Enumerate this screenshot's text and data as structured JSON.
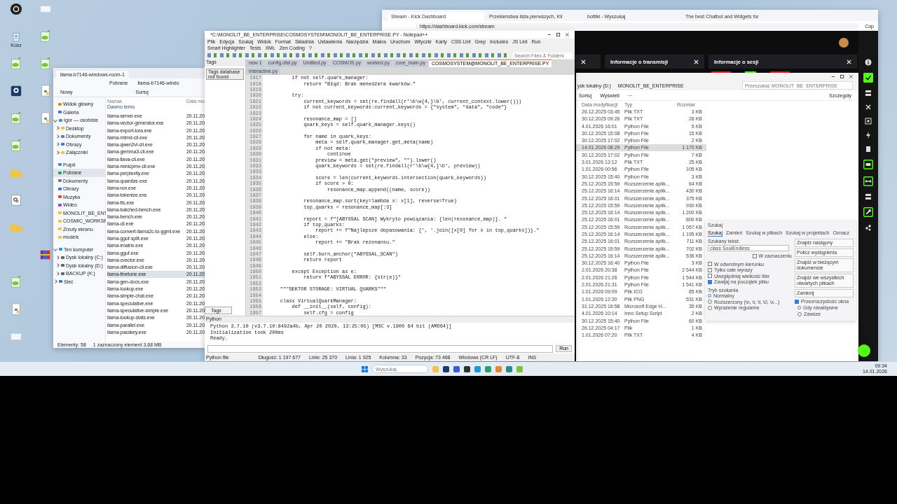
{
  "desktop": {
    "columns": [
      [
        {
          "kind": "obs"
        },
        {
          "kind": "recycle",
          "label": "Kosz"
        },
        {
          "kind": "notepad"
        },
        {
          "kind": "webcam"
        },
        {
          "kind": "notepad"
        },
        {
          "kind": "notepad"
        },
        {
          "kind": "folder"
        },
        {
          "kind": "settings"
        },
        {
          "kind": "folder"
        },
        {
          "kind": "empty"
        },
        {
          "kind": "notepad"
        },
        {
          "kind": "python"
        },
        {
          "kind": "doc"
        }
      ],
      [
        {
          "kind": "doc"
        },
        {
          "kind": "notepad"
        },
        {
          "kind": "notepad"
        },
        {
          "kind": "python"
        },
        {
          "kind": "python"
        },
        {
          "kind": "empty"
        },
        {
          "kind": "empty"
        },
        {
          "kind": "empty"
        },
        {
          "kind": "empty"
        },
        {
          "kind": "winrar"
        }
      ]
    ]
  },
  "browser": {
    "tabs": [
      {
        "title": "Stream - Kick Dashboard",
        "selected": true
      },
      {
        "title": "Przekleństwa lista pierwszych, Kli",
        "selected": false
      },
      {
        "title": "bottiki - Wyszukaj",
        "selected": false
      },
      {
        "title": "The best Chatbot and Widgets for",
        "selected": false
      }
    ],
    "url": "https://dashboard.kick.com/stream",
    "copilot": "Cop",
    "panels": [
      {
        "title": "Informacje o transmisji"
      },
      {
        "title": "Informacje o sesji"
      }
    ]
  },
  "explorer_right": {
    "breadcrumb": [
      "ysk lokalny (D:)",
      "MONOLIT_BE_ENTERPRISE"
    ],
    "search": {
      "placeholder": "Przeszukaj: MONOLIT_BE_ENTERPRISE"
    },
    "toolbar": [
      "Sortuj",
      "Wyświetl",
      "···"
    ],
    "details": "Szczegóły",
    "columns": [
      "Data modyfikacji",
      "Typ",
      "Rozmiar"
    ],
    "rows": [
      {
        "date": "26.12.2025 03:45",
        "type": "Plik TXT",
        "size": "3 KB",
        "selected": false
      },
      {
        "date": "30.12.2025 09:26",
        "type": "Plik TXT",
        "size": "26 KB",
        "selected": false
      },
      {
        "date": "4.01.2026 16:01",
        "type": "Python File",
        "size": "5 KB",
        "selected": false
      },
      {
        "date": "30.12.2025 15:08",
        "type": "Python File",
        "size": "15 KB",
        "selected": false
      },
      {
        "date": "30.12.2025 17:02",
        "type": "Python File",
        "size": "2 KB",
        "selected": false
      },
      {
        "date": "14.01.2026 08:29",
        "type": "Python File",
        "size": "1 170 KB",
        "selected": true
      },
      {
        "date": "30.12.2025 17:02",
        "type": "Python File",
        "size": "7 KB",
        "selected": false
      },
      {
        "date": "3.01.2026 12:12",
        "type": "Plik TXT",
        "size": "25 KB",
        "selected": false
      },
      {
        "date": "1.01.2026 00:56",
        "type": "Python File",
        "size": "105 KB",
        "selected": false
      },
      {
        "date": "30.12.2025 15:40",
        "type": "Python File",
        "size": "3 KB",
        "selected": false
      },
      {
        "date": "25.12.2025 15:59",
        "type": "Rozszerzenie aplik...",
        "size": "64 KB",
        "selected": false
      },
      {
        "date": "25.12.2025 16:14",
        "type": "Rozszerzenie aplik...",
        "size": "430 KB",
        "selected": false
      },
      {
        "date": "25.12.2025 16:01",
        "type": "Rozszerzenie aplik...",
        "size": "375 KB",
        "selected": false
      },
      {
        "date": "25.12.2025 15:59",
        "type": "Rozszerzenie aplik...",
        "size": "930 KB",
        "selected": false
      },
      {
        "date": "25.12.2025 16:14",
        "type": "Rozszerzenie aplik...",
        "size": "1 200 KB",
        "selected": false
      },
      {
        "date": "25.12.2025 16:01",
        "type": "Rozszerzenie aplik...",
        "size": "800 KB",
        "selected": false
      },
      {
        "date": "25.12.2025 15:59",
        "type": "Rozszerzenie aplik...",
        "size": "1 057 KB",
        "selected": false
      },
      {
        "date": "25.12.2025 16:14",
        "type": "Rozszerzenie aplik...",
        "size": "1 195 KB",
        "selected": false
      },
      {
        "date": "25.12.2025 16:01",
        "type": "Rozszerzenie aplik...",
        "size": "711 KB",
        "selected": false
      },
      {
        "date": "25.12.2025 15:59",
        "type": "Rozszerzenie aplik...",
        "size": "702 KB",
        "selected": false
      },
      {
        "date": "25.12.2025 16:14",
        "type": "Rozszerzenie aplik...",
        "size": "536 KB",
        "selected": false
      },
      {
        "date": "30.12.2025 16:40",
        "type": "Python File",
        "size": "3 KB",
        "selected": false
      },
      {
        "date": "2.01.2026 20:38",
        "type": "Python File",
        "size": "2 544 KB",
        "selected": false
      },
      {
        "date": "2.01.2026 21:26",
        "type": "Python File",
        "size": "1 544 KB",
        "selected": false
      },
      {
        "date": "2.01.2026 21:31",
        "type": "Python File",
        "size": "1 541 KB",
        "selected": false
      },
      {
        "date": "1.01.2026 09:09",
        "type": "Plik ICO",
        "size": "85 KB",
        "selected": false
      },
      {
        "date": "1.01.2026 12:30",
        "type": "Plik PNG",
        "size": "531 KB",
        "selected": false
      },
      {
        "date": "31.12.2025 16:58",
        "type": "Microsoft Edge H...",
        "size": "35 KB",
        "selected": false
      },
      {
        "date": "4.01.2026 10:14",
        "type": "Inno Setup Script",
        "size": "2 KB",
        "selected": false
      },
      {
        "date": "30.12.2025 15:40",
        "type": "Python File",
        "size": "60 KB",
        "selected": false
      },
      {
        "date": "26.12.2025 04:17",
        "type": "Plik",
        "size": "1 KB",
        "selected": false
      },
      {
        "date": "1.01.2026 07:20",
        "type": "Plik TXT",
        "size": "4 KB",
        "selected": false
      }
    ]
  },
  "explorer_left": {
    "tab": "llama-b7146-windows-rocm-1",
    "breadcrumb": [
      "Pobrane",
      "llama-b7146-windo"
    ],
    "toolbar": [
      "Nowy",
      "Sortuj"
    ],
    "nav": [
      [
        {
          "label": "Widok główny",
          "kind": "home",
          "selected": false
        },
        {
          "label": "Galeria",
          "kind": "gallery",
          "selected": false
        },
        {
          "label": "Igor — osobiste",
          "kind": "cloud",
          "selected": false,
          "expanded": true,
          "children": [
            {
              "label": "Desktop",
              "kind": "folder",
              "selected": false,
              "expanded": false
            },
            {
              "label": "Dokumenty",
              "kind": "doc",
              "selected": false,
              "expanded": false
            },
            {
              "label": "Obrazy",
              "kind": "image",
              "selected": false,
              "expanded": false
            },
            {
              "label": "Załączniki",
              "kind": "folder",
              "selected": false,
              "expanded": false
            }
          ]
        }
      ],
      [
        {
          "label": "Pulpit",
          "kind": "desktop",
          "selected": false
        },
        {
          "label": "Pobrane",
          "kind": "download",
          "selected": true
        },
        {
          "label": "Dokumenty",
          "kind": "doc",
          "selected": false
        },
        {
          "label": "Obrazy",
          "kind": "image",
          "selected": false
        },
        {
          "label": "Muzyka",
          "kind": "music",
          "selected": false
        },
        {
          "label": "Wideo",
          "kind": "video",
          "selected": false
        },
        {
          "label": "MONOLIT_BE_ENT",
          "kind": "folder",
          "selected": false
        },
        {
          "label": "COSMIC_WORKSP",
          "kind": "folder",
          "selected": false
        },
        {
          "label": "Zrzuty ekranu",
          "kind": "folder",
          "selected": false
        },
        {
          "label": "models",
          "kind": "folder",
          "selected": false
        }
      ],
      [
        {
          "label": "Ten komputer",
          "kind": "pc",
          "selected": false,
          "expanded": true,
          "children": [
            {
              "label": "Dysk lokalny (C:)",
              "kind": "drive",
              "selected": false,
              "expanded": false
            },
            {
              "label": "Dysk lokalny (D:)",
              "kind": "drive",
              "selected": false,
              "expanded": false
            },
            {
              "label": "BACKUP (K:)",
              "kind": "drive",
              "selected": false,
              "expanded": false
            }
          ]
        },
        {
          "label": "Sieć",
          "kind": "network",
          "selected": false,
          "expanded": false
        }
      ]
    ],
    "columns": [
      "Nazwa",
      "Data mo"
    ],
    "group": "Dawno temu",
    "files": [
      {
        "name": "llama-server.exe",
        "date": "20.11.20",
        "selected": false
      },
      {
        "name": "llama-vector-generator.exe",
        "date": "20.11.20",
        "selected": false
      },
      {
        "name": "llama-export-lora.exe",
        "date": "20.11.20",
        "selected": false
      },
      {
        "name": "llama-mtmd-cli.exe",
        "date": "20.11.20",
        "selected": false
      },
      {
        "name": "llama-qwen2vl-cli.exe",
        "date": "20.11.20",
        "selected": false
      },
      {
        "name": "llama-gemma3-cli.exe",
        "date": "20.11.20",
        "selected": false
      },
      {
        "name": "llama-llava-cli.exe",
        "date": "20.11.20",
        "selected": false
      },
      {
        "name": "llama-minicpmv-cli.exe",
        "date": "20.11.20",
        "selected": false
      },
      {
        "name": "llama-perplexity.exe",
        "date": "20.11.20",
        "selected": false
      },
      {
        "name": "llama-quantize.exe",
        "date": "20.11.20",
        "selected": false
      },
      {
        "name": "llama-run.exe",
        "date": "20.11.20",
        "selected": false
      },
      {
        "name": "llama-tokenize.exe",
        "date": "20.11.20",
        "selected": false
      },
      {
        "name": "llama-tts.exe",
        "date": "20.11.20",
        "selected": false
      },
      {
        "name": "llama-batched-bench.exe",
        "date": "20.11.20",
        "selected": false
      },
      {
        "name": "llama-bench.exe",
        "date": "20.11.20",
        "selected": false
      },
      {
        "name": "llama-cli.exe",
        "date": "20.11.20",
        "selected": false
      },
      {
        "name": "llama-convert-llama2c-to-ggml.exe",
        "date": "20.11.20",
        "selected": false
      },
      {
        "name": "llama-gguf-split.exe",
        "date": "20.11.20",
        "selected": false
      },
      {
        "name": "llama-imatrix.exe",
        "date": "20.11.20",
        "selected": false
      },
      {
        "name": "llama-gguf.exe",
        "date": "20.11.20",
        "selected": false
      },
      {
        "name": "llama-cvector.exe",
        "date": "20.11.20",
        "selected": false
      },
      {
        "name": "llama-diffusion-cli.exe",
        "date": "20.11.20",
        "selected": false
      },
      {
        "name": "llama-finetune.exe",
        "date": "20.11.20",
        "selected": true
      },
      {
        "name": "llama-gen-docs.exe",
        "date": "20.11.20",
        "selected": false
      },
      {
        "name": "llama-lookup.exe",
        "date": "20.11.20",
        "selected": false
      },
      {
        "name": "llama-simple-chat.exe",
        "date": "20.11.20",
        "selected": false
      },
      {
        "name": "llama-speculative.exe",
        "date": "20.11.20",
        "selected": false
      },
      {
        "name": "llama-speculative-simple.exe",
        "date": "20.11.20",
        "selected": false
      },
      {
        "name": "llama-lookup-stats.exe",
        "date": "20.11.20",
        "selected": false
      },
      {
        "name": "llama-parallel.exe",
        "date": "20.11.20",
        "selected": false
      },
      {
        "name": "llama-passkey.exe",
        "date": "20.11.20",
        "selected": false
      }
    ],
    "status": [
      "Elementy: 58",
      "1 zaznaczony element  3,68 MB"
    ]
  },
  "editor": {
    "title": "*C:\\MONOLIT_BE_ENTERPRISE\\COSMOSYSTEM\\MONOLIT_BE_ENTERPRISE.PY - Notepad++",
    "menu": [
      "Plik",
      "Edycja",
      "Szukaj",
      "Widok",
      "Format",
      "Składnia",
      "Ustawienia",
      "Narzędzia",
      "Makra",
      "Uruchom",
      "Wtyczki",
      "Karty",
      "CSS Lint",
      "Grep",
      "Includes",
      "JS Lint",
      "Run",
      "Smart Highlighter",
      "Tests",
      "XML",
      "Zen Coding",
      "?"
    ],
    "search": {
      "placeholder": "Search Files & Folders"
    },
    "tabs": [
      {
        "title": "new 1",
        "selected": false
      },
      {
        "title": "config.dist.py",
        "selected": false
      },
      {
        "title": "Untitled.py",
        "selected": false
      },
      {
        "title": "COSMOS.py",
        "selected": false
      },
      {
        "title": "worked.py",
        "selected": false
      },
      {
        "title": "core_main.py",
        "selected": false
      },
      {
        "title": "COSMOSYSTEM@MONOLIT_BE_ENTERPRISE.PY",
        "selected": true
      },
      {
        "title": "interactive.py",
        "selected": false
      }
    ],
    "tags": {
      "title": "Tags",
      "message": "Tags database not found",
      "tab": "Tags"
    },
    "lines": [
      {
        "n": "1917",
        "code": "        if not self.quark_manager:"
      },
      {
        "n": "1918",
        "code": "            return \"Błąd: Brak menedżera kwarków.\""
      },
      {
        "n": "1919"
      },
      {
        "n": "1920",
        "code": "        try:"
      },
      {
        "n": "1921",
        "code": "            current_keywords = set(re.findall(r'\\b\\w{4,}\\b', current_context.lower()))"
      },
      {
        "n": "1922",
        "code": "            if not current_keywords:current_keywords = {\"system\", \"data\", \"code\"}"
      },
      {
        "n": "1923"
      },
      {
        "n": "1924",
        "code": "            resonance_map = []"
      },
      {
        "n": "1925",
        "code": "            quark_keys = self.quark_manager.keys()"
      },
      {
        "n": "1926"
      },
      {
        "n": "1927",
        "code": "            for name in quark_keys:"
      },
      {
        "n": "1928",
        "code": "                meta = self.quark_manager.get_meta(name)"
      },
      {
        "n": "1929",
        "code": "                if not meta:"
      },
      {
        "n": "1930",
        "code": "                    continue"
      },
      {
        "n": "1931",
        "code": "                preview = meta.get(\"preview\", \"\").lower()"
      },
      {
        "n": "1932",
        "code": "                quark_keywords = set(re.findall(r'\\b\\w{4,}\\b', preview))"
      },
      {
        "n": "1933"
      },
      {
        "n": "1934",
        "code": "                score = len(current_keywords.intersection(quark_keywords))"
      },
      {
        "n": "1935",
        "code": "                if score > 0:"
      },
      {
        "n": "1936",
        "code": "                    resonance_map.append((name, score))"
      },
      {
        "n": "1937"
      },
      {
        "n": "1938",
        "code": "            resonance_map.sort(key=lambda x: x[1], reverse=True)"
      },
      {
        "n": "1939",
        "code": "            top_quarks = resonance_map[:3]"
      },
      {
        "n": "1940"
      },
      {
        "n": "1941",
        "code": "            report = f\"[ABYSSAL SCAN] Wykryto powiązania: {len(resonance_map)}. \""
      },
      {
        "n": "1942",
        "code": "            if top_quarks:"
      },
      {
        "n": "1943",
        "code": "                report += f\"Najlepsze dopasowania: {', '.join([x[0] for x in top_quarks])}.\""
      },
      {
        "n": "1944",
        "code": "            else:"
      },
      {
        "n": "1945",
        "code": "                report += \"Brak rezonansu.\""
      },
      {
        "n": "1946"
      },
      {
        "n": "1947",
        "code": "            self.burn_anchor(\"ABYSSAL_SCAN\")"
      },
      {
        "n": "1948",
        "code": "            return report"
      },
      {
        "n": "1949"
      },
      {
        "n": "1950",
        "code": "        except Exception as e:"
      },
      {
        "n": "1951",
        "code": "            return f\"ABYSSAL ERROR: {str(e)}\""
      },
      {
        "n": "1952"
      },
      {
        "n": "1953",
        "code": "    \"\"\"SEKTOR STORAGE: VIRTUAL QUARKS\"\"\""
      },
      {
        "n": "1954"
      },
      {
        "n": "1955",
        "code": "    class VirtualQuarkManager:"
      },
      {
        "n": "1956",
        "code": "        def __init__(self, config):"
      },
      {
        "n": "1957",
        "code": "            self.cfg = config"
      }
    ],
    "console": {
      "title": "Python",
      "lines": [
        "Python 3.7.10 (v3.7.10:8492a4b, Apr 20 2020, 13:25:05) [MSC v.1900 64 bit (AMD64)]",
        "Initialization took 200ms",
        "Ready."
      ],
      "run": "Run"
    },
    "status": [
      "Python file",
      "Długość: 1 197 677",
      "Linie: 25 370",
      "Linia: 1 925",
      "Kolumna: 33",
      "Pozycja: 73 468",
      "Windows (CR LF)",
      "UTF-8",
      "INS"
    ]
  },
  "find": {
    "title": "Szukaj",
    "tabs": [
      {
        "label": "Szukaj",
        "selected": true
      },
      {
        "label": "Zamień",
        "selected": false
      },
      {
        "label": "Szukaj w plikach",
        "selected": false
      },
      {
        "label": "Szukaj w projektach",
        "selected": false
      },
      {
        "label": "Oznacz",
        "selected": false
      }
    ],
    "field_label": "Szukany tekst:",
    "value": "class SoulEndless",
    "in_selection": {
      "label": "W zaznaczeniu",
      "checked": false
    },
    "options": [
      {
        "label": "W odwrotnym kierunku",
        "checked": false
      },
      {
        "label": "Tylko całe wyrazy",
        "checked": false
      },
      {
        "label": "Uwzględniaj wielkość liter",
        "checked": false
      },
      {
        "label": "Zawijaj na początek pliku",
        "checked": true
      }
    ],
    "mode_title": "Tryb szukania",
    "modes": [
      {
        "label": "Normalny",
        "selected": true
      },
      {
        "label": "Rozszerzony (\\n, \\r, \\t, \\0, \\x...)",
        "selected": false
      },
      {
        "label": "Wyrażenie regularne",
        "selected": false
      }
    ],
    "buttons": [
      "Znajdź następny",
      "Policz wystąpienia",
      "Znajdź w bieżącym dokumencie",
      "Znajdź we wszystkich otwartych plikach",
      "Zamknij"
    ],
    "transparency": {
      "label": "Przezroczystość okna",
      "checked": true,
      "modes": [
        {
          "label": "Gdy nieaktywne",
          "selected": true
        },
        {
          "label": "Zawsze",
          "selected": false
        }
      ]
    }
  },
  "taskbar": {
    "search": {
      "placeholder": "Wyszukaj"
    },
    "time": "09:34",
    "date": "14.01.2026"
  }
}
